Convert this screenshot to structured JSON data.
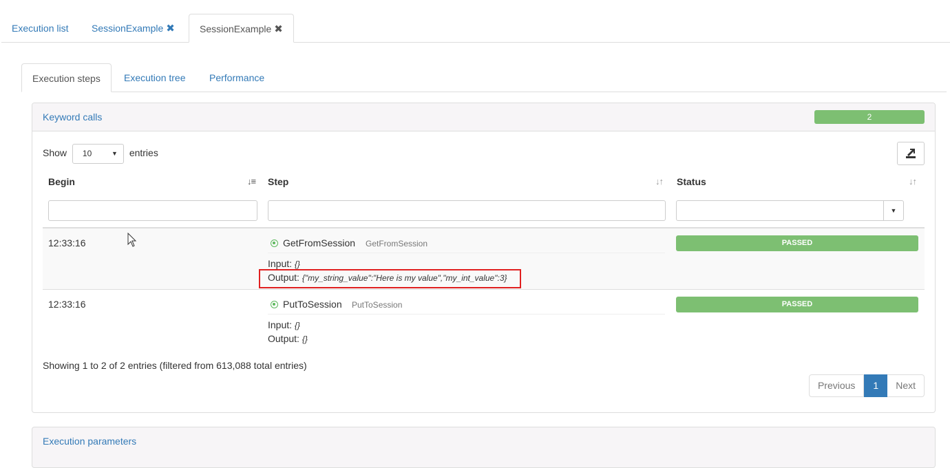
{
  "top_tabs": [
    {
      "label": "Execution list"
    },
    {
      "label": "SessionExample"
    },
    {
      "label": "SessionExample"
    }
  ],
  "close_glyph": "✖",
  "sub_tabs": [
    {
      "label": "Execution steps"
    },
    {
      "label": "Execution tree"
    },
    {
      "label": "Performance"
    }
  ],
  "keyword_panel": {
    "title": "Keyword calls",
    "count": "2"
  },
  "length_control": {
    "prefix": "Show",
    "value": "10",
    "suffix": "entries"
  },
  "columns": [
    "Begin",
    "Step",
    "Status"
  ],
  "rows": [
    {
      "begin": "12:33:16",
      "step_name": "GetFromSession",
      "step_sub": "GetFromSession",
      "input_label": "Input:",
      "input_value": "{}",
      "output_label": "Output:",
      "output_value": "{\"my_string_value\":\"Here is my value\",\"my_int_value\":3}",
      "status": "PASSED"
    },
    {
      "begin": "12:33:16",
      "step_name": "PutToSession",
      "step_sub": "PutToSession",
      "input_label": "Input:",
      "input_value": "{}",
      "output_label": "Output:",
      "output_value": "{}",
      "status": "PASSED"
    }
  ],
  "info": "Showing 1 to 2 of 2 entries (filtered from 613,088 total entries)",
  "pagination": {
    "previous": "Previous",
    "current": "1",
    "next": "Next"
  },
  "params_panel": {
    "title": "Execution parameters"
  },
  "colors": {
    "link": "#337ab7",
    "success": "#7dbf72",
    "highlight": "#e02020"
  }
}
